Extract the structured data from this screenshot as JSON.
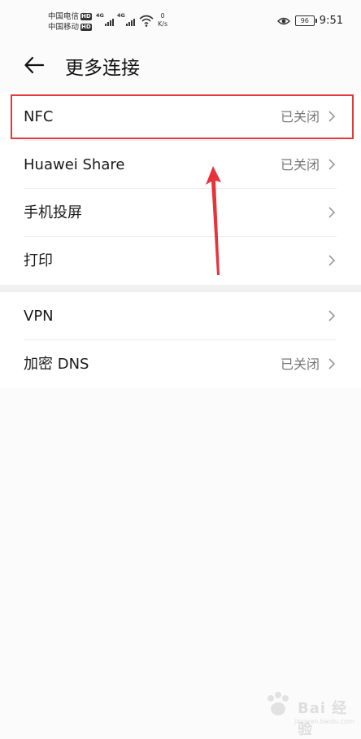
{
  "statusbar": {
    "carrier1": "中国电信",
    "carrier2": "中国移动",
    "hd": "HD",
    "net1": "4G",
    "net2": "4G",
    "speed_value": "0",
    "speed_unit": "K/s",
    "battery": "96",
    "time": "9:51"
  },
  "header": {
    "title": "更多连接",
    "back_icon": "arrow-left-icon"
  },
  "group1": [
    {
      "label": "NFC",
      "status": "已关闭"
    },
    {
      "label": "Huawei Share",
      "status": "已关闭"
    },
    {
      "label": "手机投屏",
      "status": ""
    },
    {
      "label": "打印",
      "status": ""
    }
  ],
  "group2": [
    {
      "label": "VPN",
      "status": ""
    },
    {
      "label": "加密 DNS",
      "status": "已关闭"
    }
  ],
  "annotation": {
    "highlight_color": "#e23a3a",
    "arrow_color": "#e8323a"
  },
  "watermark": {
    "text": "Bai 经验",
    "url": "jingyan.baidu.com"
  }
}
